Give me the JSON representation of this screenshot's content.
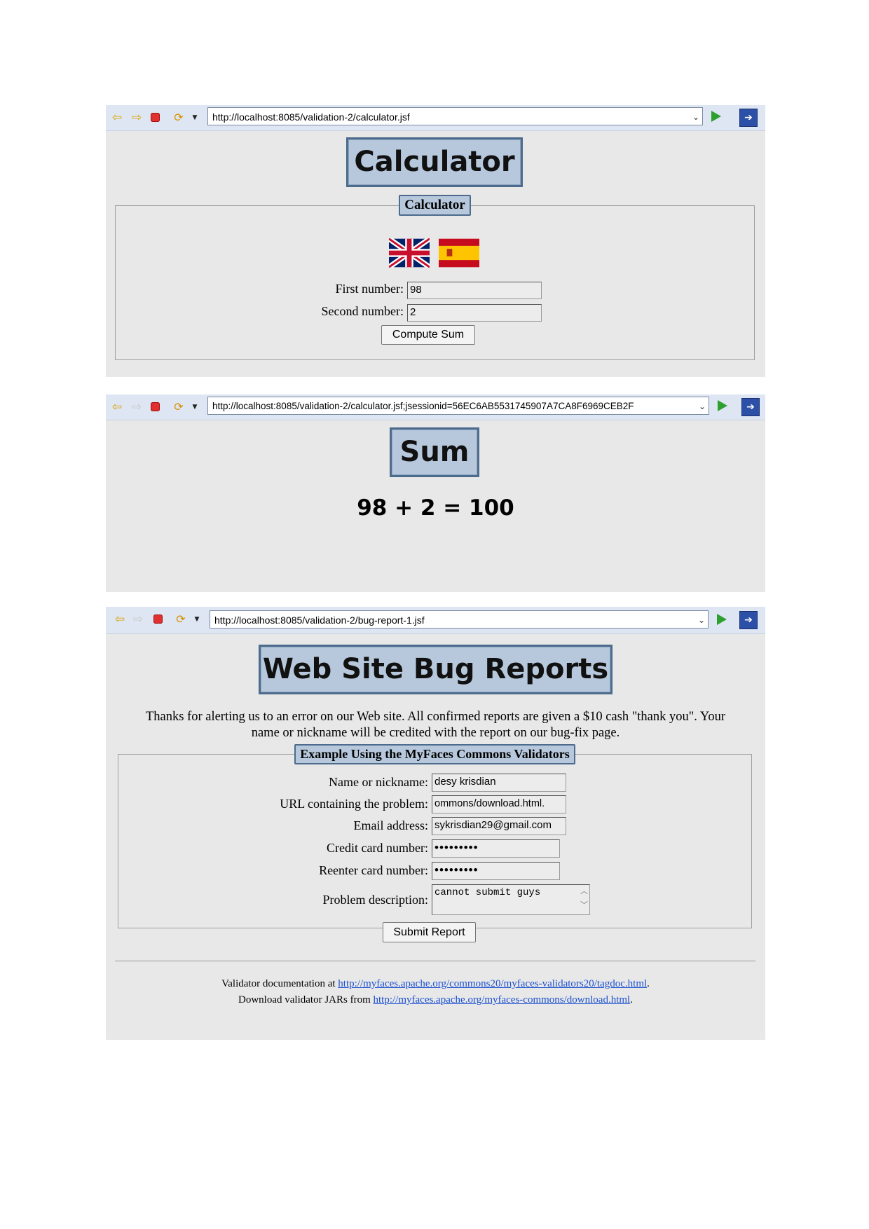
{
  "calculator_window": {
    "url": "http://localhost:8085/validation-2/calculator.jsf",
    "page_title": "Calculator",
    "form_legend": "Calculator",
    "first_number_label": "First number:",
    "first_number_value": "98",
    "second_number_label": "Second number:",
    "second_number_value": "2",
    "compute_button": "Compute Sum"
  },
  "sum_window": {
    "url": "http://localhost:8085/validation-2/calculator.jsf;jsessionid=56EC6AB5531745907A7CA8F6969CEB2F",
    "page_title": "Sum",
    "result": "98 + 2 = 100"
  },
  "bug_report_window": {
    "url": "http://localhost:8085/validation-2/bug-report-1.jsf",
    "page_title": "Web Site Bug Reports",
    "intro_line1": "Thanks for alerting us to an error on our Web site. All confirmed reports are given a $10 cash \"thank you\". Your",
    "intro_line2": "name or nickname will be credited with the report on our bug-fix page.",
    "form_legend": "Example Using the MyFaces Commons Validators",
    "fields": {
      "name_label": "Name or nickname:",
      "name_value": "desy krisdian",
      "url_label": "URL containing the problem:",
      "url_value": "ommons/download.html.",
      "email_label": "Email address:",
      "email_value": "sykrisdian29@gmail.com",
      "card_label": "Credit card number:",
      "card_value": "•••••••••",
      "reenter_label": "Reenter card number:",
      "reenter_value": "•••••••••",
      "problem_label": "Problem description:",
      "problem_value": "cannot submit guys"
    },
    "submit_button": "Submit Report",
    "footer": {
      "doc_prefix": "Validator documentation at ",
      "doc_link": "http://myfaces.apache.org/commons20/myfaces-validators20/tagdoc.html",
      "doc_suffix": ".",
      "jar_prefix": "Download validator JARs from ",
      "jar_link": "http://myfaces.apache.org/myfaces-commons/download.html",
      "jar_suffix": "."
    }
  },
  "icons": [
    "back-arrow-icon",
    "forward-arrow-icon",
    "stop-icon",
    "refresh-icon",
    "dropdown-icon",
    "go-icon",
    "external-browser-icon",
    "uk-flag-icon",
    "spain-flag-icon"
  ]
}
